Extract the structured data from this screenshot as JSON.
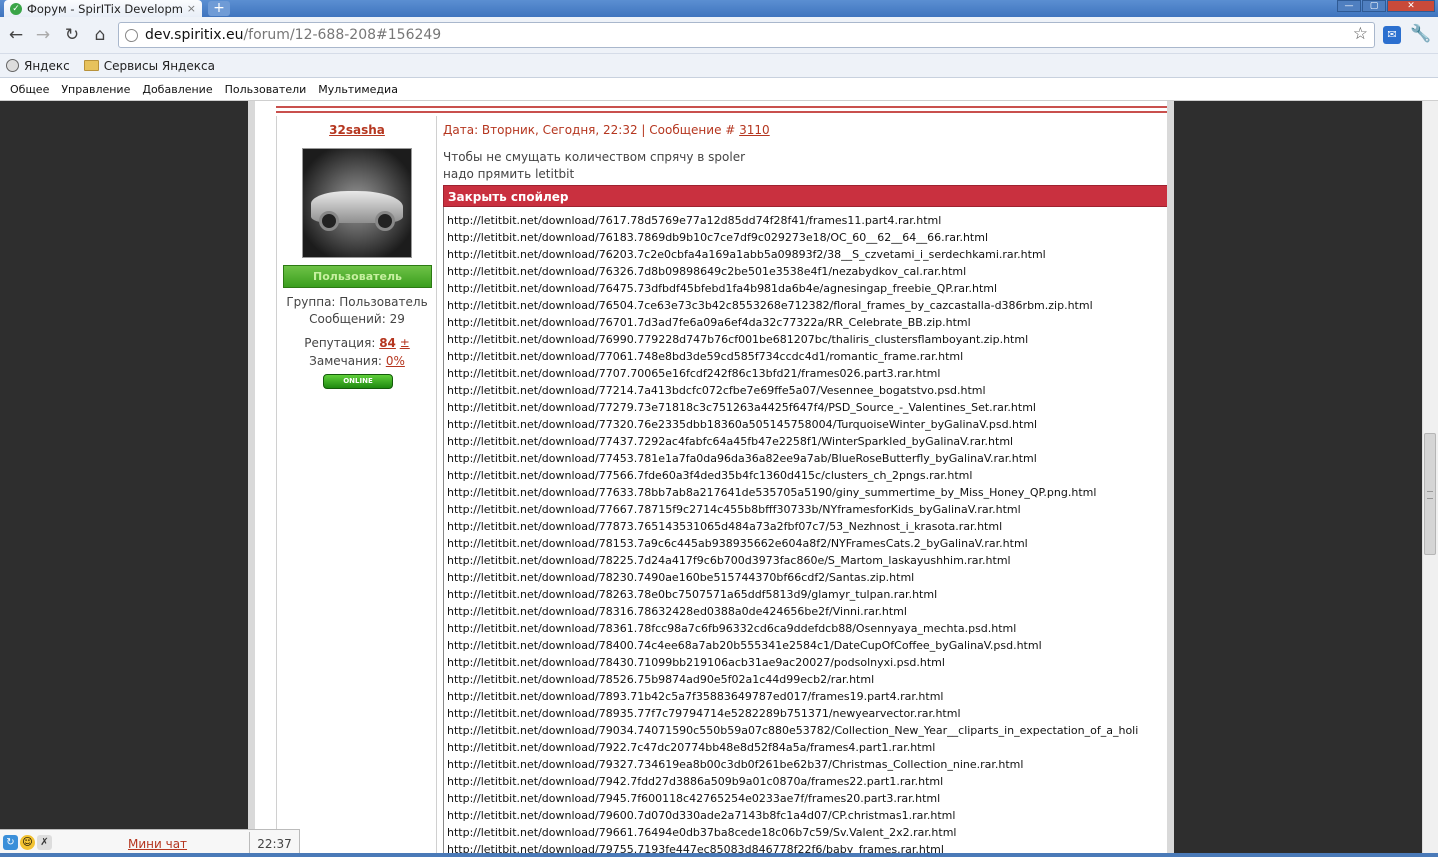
{
  "browser": {
    "tab_title": "Форум - SpirITix Developm",
    "tab_close": "×",
    "new_tab": "+",
    "url_host": "dev.spiritix.eu",
    "url_path": "/forum/12-688-208#156249",
    "bookmarks": [
      "Яндекс",
      "Сервисы Яндекса"
    ]
  },
  "adminbar": {
    "items": [
      "Общее",
      "Управление",
      "Добавление",
      "Пользователи",
      "Мультимедиа"
    ]
  },
  "user": {
    "name": "32sasha",
    "rank": "Пользователь",
    "group": "Группа: Пользователь",
    "messages": "Сообщений: 29",
    "rep_label": "Репутация:",
    "rep_value": "84",
    "rep_pm": "±",
    "warn_label": "Замечания:",
    "warn_value": "0%",
    "online": "ONLINE"
  },
  "post": {
    "header_prefix": "Дата: Вторник, Сегодня, 22:32 | Сообщение # ",
    "number": "3110",
    "line1": "Чтобы не смущать количеством спрячу в spoler",
    "line2": "надо прямить letitbit",
    "spoiler_label": "Закрыть спойлер",
    "links": [
      "http://letitbit.net/download/7617.78d5769e77a12d85dd74f28f41/frames11.part4.rar.html",
      "http://letitbit.net/download/76183.7869db9b10c7ce7df9c029273e18/OC_60__62__64__66.rar.html",
      "http://letitbit.net/download/76203.7c2e0cbfa4a169a1abb5a09893f2/38__S_czvetami_i_serdechkami.rar.html",
      "http://letitbit.net/download/76326.7d8b09898649c2be501e3538e4f1/nezabydkov_cal.rar.html",
      "http://letitbit.net/download/76475.73dfbdf45bfebd1fa4b981da6b4e/agnesingap_freebie_QP.rar.html",
      "http://letitbit.net/download/76504.7ce63e73c3b42c8553268e712382/floral_frames_by_cazcastalla-d386rbm.zip.html",
      "http://letitbit.net/download/76701.7d3ad7fe6a09a6ef4da32c77322a/RR_Celebrate_BB.zip.html",
      "http://letitbit.net/download/76990.779228d747b76cf001be681207bc/thaliris_clustersflamboyant.zip.html",
      "http://letitbit.net/download/77061.748e8bd3de59cd585f734ccdc4d1/romantic_frame.rar.html",
      "http://letitbit.net/download/7707.70065e16fcdf242f86c13bfd21/frames026.part3.rar.html",
      "http://letitbit.net/download/77214.7a413bdcfc072cfbe7e69ffe5a07/Vesennee_bogatstvo.psd.html",
      "http://letitbit.net/download/77279.73e71818c3c751263a4425f647f4/PSD_Source_-_Valentines_Set.rar.html",
      "http://letitbit.net/download/77320.76e2335dbb18360a505145758004/TurquoiseWinter_byGalinaV.psd.html",
      "http://letitbit.net/download/77437.7292ac4fabfc64a45fb47e2258f1/WinterSparkled_byGalinaV.rar.html",
      "http://letitbit.net/download/77453.781e1a7fa0da96da36a82ee9a7ab/BlueRoseButterfly_byGalinaV.rar.html",
      "http://letitbit.net/download/77566.7fde60a3f4ded35b4fc1360d415c/clusters_ch_2pngs.rar.html",
      "http://letitbit.net/download/77633.78bb7ab8a217641de535705a5190/giny_summertime_by_Miss_Honey_QP.png.html",
      "http://letitbit.net/download/77667.78715f9c2714c455b8bfff30733b/NYframesforKids_byGalinaV.rar.html",
      "http://letitbit.net/download/77873.765143531065d484a73a2fbf07c7/53_Nezhnost_i_krasota.rar.html",
      "http://letitbit.net/download/78153.7a9c6c445ab938935662e604a8f2/NYFramesCats.2_byGalinaV.rar.html",
      "http://letitbit.net/download/78225.7d24a417f9c6b700d3973fac860e/S_Martom_laskayushhim.rar.html",
      "http://letitbit.net/download/78230.7490ae160be515744370bf66cdf2/Santas.zip.html",
      "http://letitbit.net/download/78263.78e0bc7507571a65ddf5813d9/glamyr_tulpan.rar.html",
      "http://letitbit.net/download/78316.78632428ed0388a0de424656be2f/Vinni.rar.html",
      "http://letitbit.net/download/78361.78fcc98a7c6fb96332cd6ca9ddefdcb88/Osennyaya_mechta.psd.html",
      "http://letitbit.net/download/78400.74c4ee68a7ab20b555341e2584c1/DateCupOfCoffee_byGalinaV.psd.html",
      "http://letitbit.net/download/78430.71099bb219106acb31ae9ac20027/podsolnyxi.psd.html",
      "http://letitbit.net/download/78526.75b9874ad90e5f02a1c44d99ecb2/rar.html",
      "http://letitbit.net/download/7893.71b42c5a7f35883649787ed017/frames19.part4.rar.html",
      "http://letitbit.net/download/78935.77f7c79794714e5282289b751371/newyearvector.rar.html",
      "http://letitbit.net/download/79034.74071590c550b59a07c880e53782/Collection_New_Year__cliparts_in_expectation_of_a_holi",
      "http://letitbit.net/download/7922.7c47dc20774bb48e8d52f84a5a/frames4.part1.rar.html",
      "http://letitbit.net/download/79327.734619ea8b00c3db0f261be62b37/Christmas_Collection_nine.rar.html",
      "http://letitbit.net/download/7942.7fdd27d3886a509b9a01c0870a/frames22.part1.rar.html",
      "http://letitbit.net/download/7945.7f600118c42765254e0233ae7f/frames20.part3.rar.html",
      "http://letitbit.net/download/79600.7d070d330ade2a7143b8fc1a4d07/CP.christmas1.rar.html",
      "http://letitbit.net/download/79661.76494e0db37ba8cede18c06b7c59/Sv.Valent_2x2.rar.html",
      "http://letitbit.net/download/79755.7193fe447ec85083d846778f22f6/baby_frames.rar.html"
    ]
  },
  "chat": {
    "title": "Мини чат",
    "time": "22:37"
  }
}
